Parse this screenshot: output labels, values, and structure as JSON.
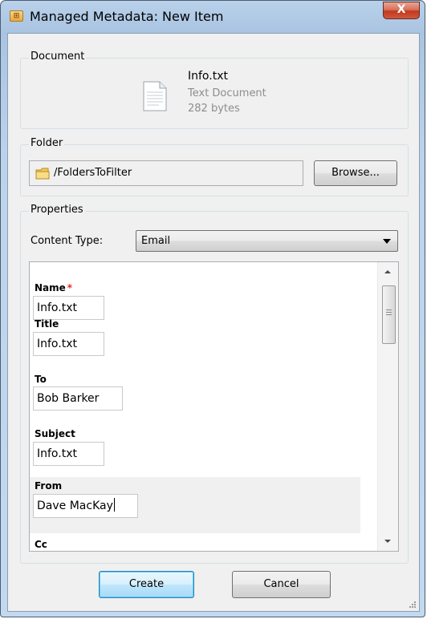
{
  "window": {
    "title": "Managed Metadata: New Item",
    "icon": "app-folder-icon",
    "close_label": "X"
  },
  "document": {
    "group_label": "Document",
    "file_name": "Info.txt",
    "file_type": "Text Document",
    "file_size": "282 bytes",
    "icon": "text-file-icon"
  },
  "folder": {
    "group_label": "Folder",
    "path": "/FoldersToFilter",
    "browse_label": "Browse..."
  },
  "properties": {
    "group_label": "Properties",
    "content_type_label": "Content Type:",
    "content_type_value": "Email",
    "fields": [
      {
        "label": "Name",
        "required_mark": "*",
        "value": "Info.txt"
      },
      {
        "label": "Title",
        "value": "Info.txt"
      },
      {
        "label": "To",
        "value": "Bob Barker"
      },
      {
        "label": "Subject",
        "value": "Info.txt"
      },
      {
        "label": "From",
        "value": "Dave MacKay"
      },
      {
        "label": "Cc",
        "value": ""
      }
    ]
  },
  "actions": {
    "create_label": "Create",
    "cancel_label": "Cancel"
  }
}
